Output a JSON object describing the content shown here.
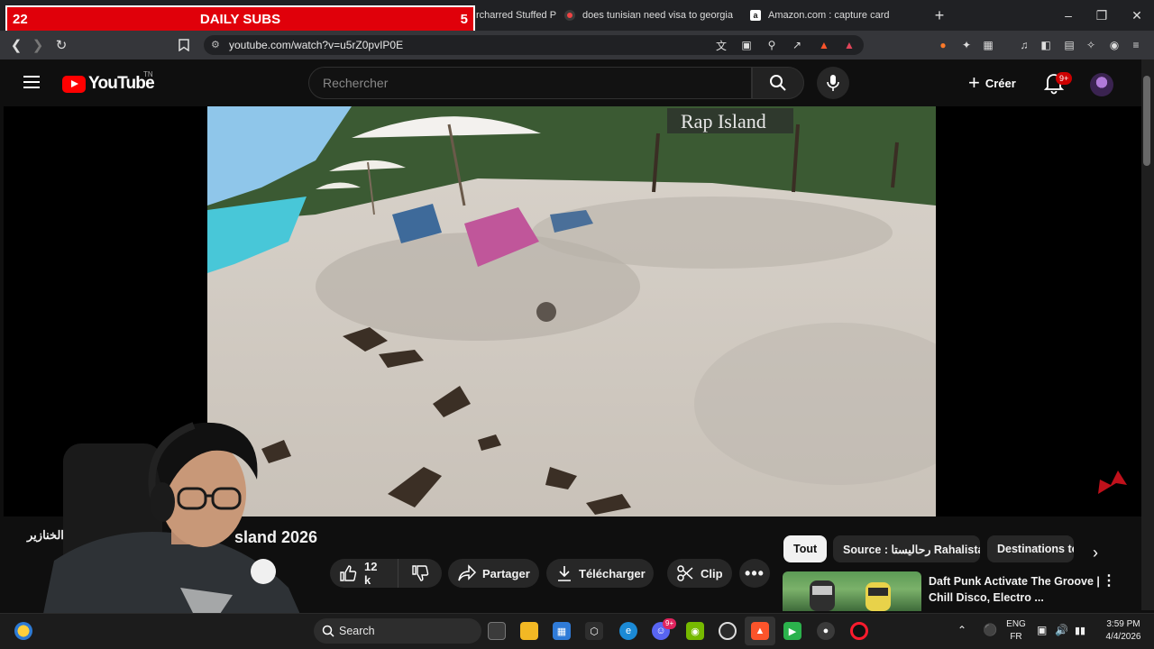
{
  "overlay": {
    "left_count": "22",
    "label": "DAILY SUBS",
    "right_count": "5"
  },
  "browser": {
    "tabs": [
      {
        "title": "rcharred Stuffed P"
      },
      {
        "title": "does tunisian need visa to georgia - I"
      },
      {
        "title": "Amazon.com : capture card"
      }
    ],
    "new_tab": "+",
    "url": "youtube.com/watch?v=u5rZ0pvIP0E"
  },
  "youtube": {
    "logo_text": "YouTube",
    "country_code": "TN",
    "search_placeholder": "Rechercher",
    "create_label": "Créer",
    "notif_badge": "9+",
    "video": {
      "title_visible": "sland 2026",
      "sign_text": "Rap Island",
      "channel_visible": "تا الخنازير",
      "likes": "12 k",
      "share_label": "Partager",
      "download_label": "Télécharger",
      "clip_label": "Clip"
    },
    "chips": [
      "Tout",
      "Source : رحاليستا Rahalista",
      "Destinations to"
    ],
    "suggestion": {
      "title": "Daft Punk Activate The Groove | Chill Disco, Electro ..."
    }
  },
  "taskbar": {
    "search_label": "Search",
    "lang_top": "ENG",
    "lang_bottom": "FR",
    "time": "3:59 PM",
    "date": "4/4/2026",
    "discord_badge": "9+"
  },
  "colors": {
    "overlay_red": "#e0000a",
    "yt_red": "#ff0000",
    "bg": "#0f0f0f"
  }
}
